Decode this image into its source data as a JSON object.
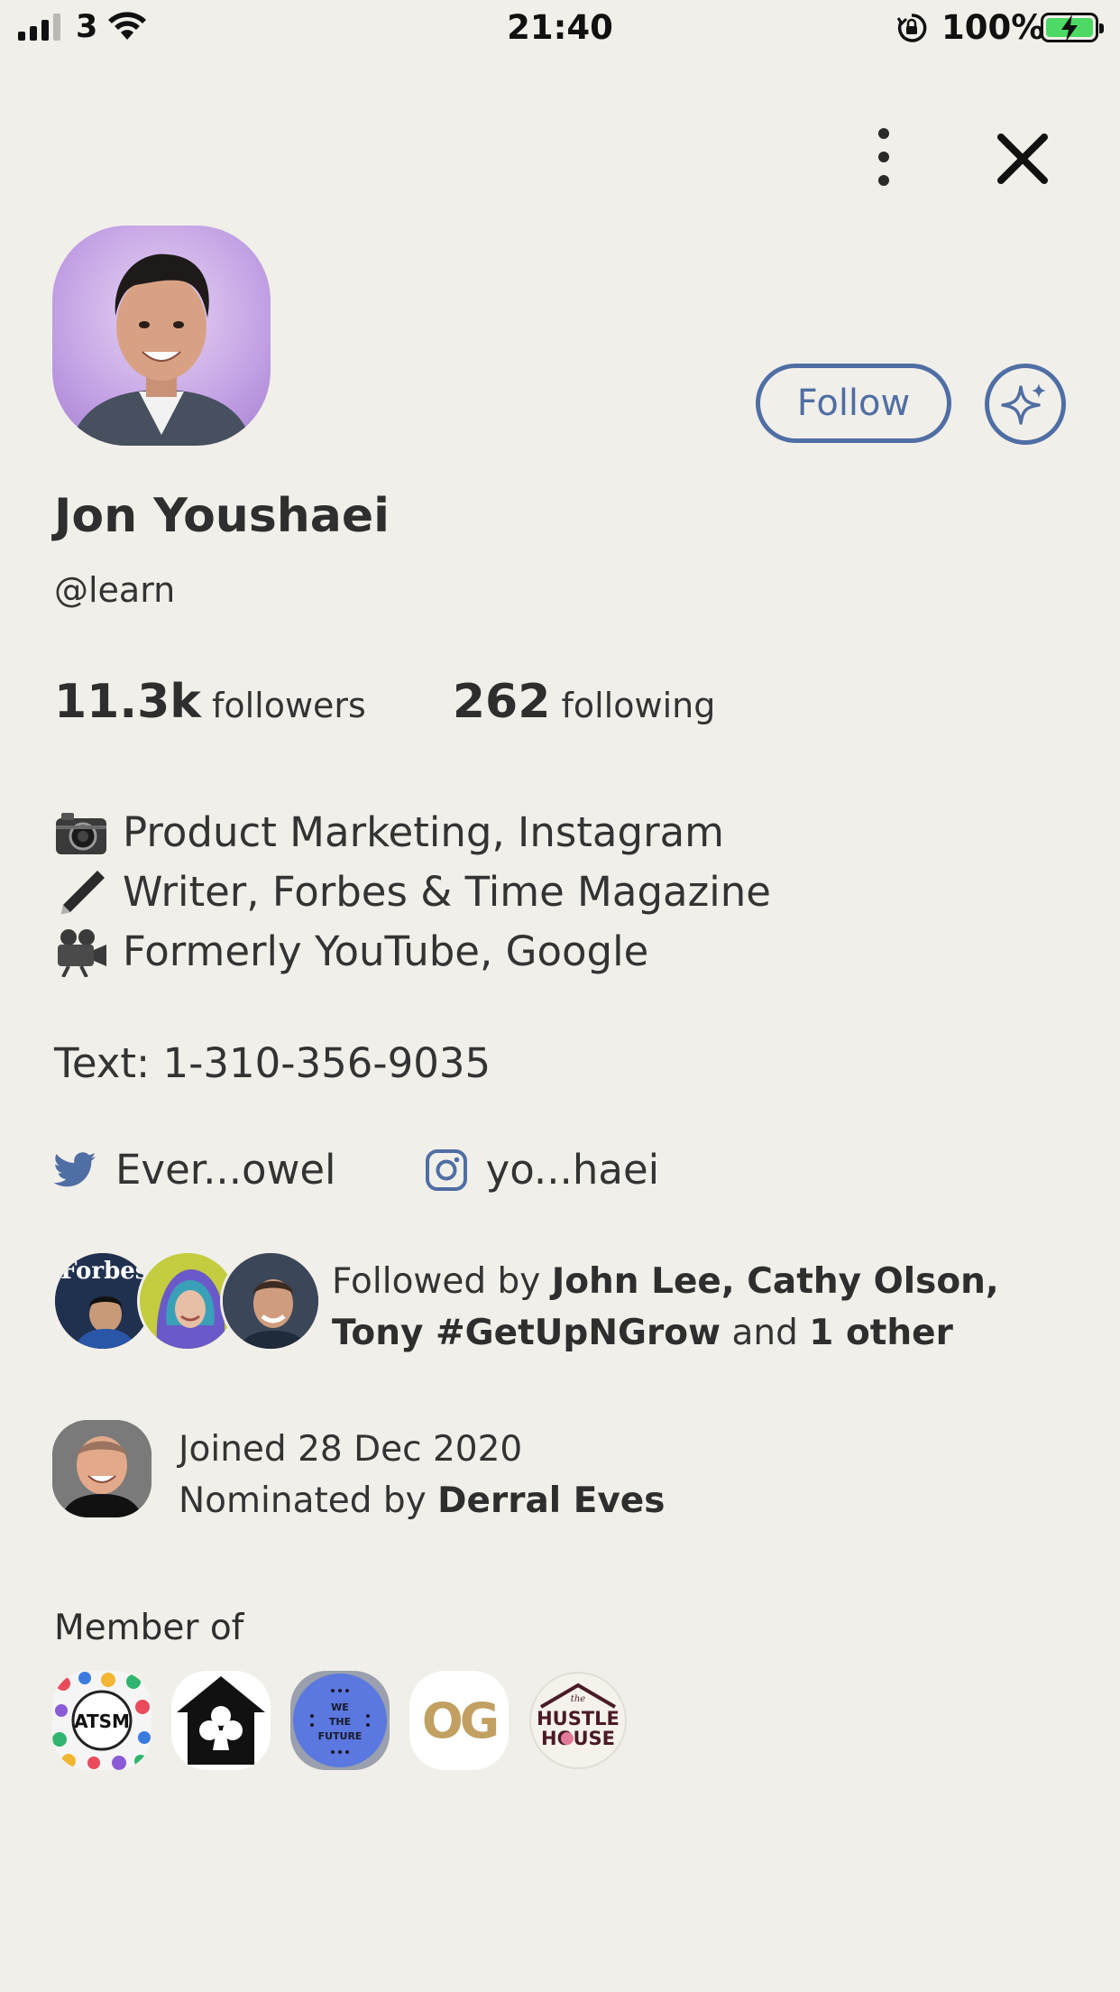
{
  "status_bar": {
    "carrier": "3",
    "time": "21:40",
    "battery_percent": "100%"
  },
  "profile": {
    "name": "Jon Youshaei",
    "handle": "@learn",
    "followers_count": "11.3k",
    "followers_label": "followers",
    "following_count": "262",
    "following_label": "following",
    "follow_label": "Follow"
  },
  "bio": {
    "lines": [
      {
        "icon": "camera-icon",
        "text": "Product Marketing, Instagram"
      },
      {
        "icon": "pen-icon",
        "text": "Writer, Forbes & Time Magazine"
      },
      {
        "icon": "movie-camera-icon",
        "text": "Formerly YouTube, Google"
      }
    ],
    "contact": "Text: 1-310-356-9035"
  },
  "socials": {
    "twitter": "Ever...owel",
    "instagram": "yo...haei"
  },
  "followed_by": {
    "prefix": "Followed by ",
    "names": "John Lee, Cathy Olson, Tony #GetUpNGrow",
    "and": " and ",
    "other": "1 other"
  },
  "joined": {
    "date_text": "Joined 28 Dec 2020",
    "nominated_prefix": "Nominated by ",
    "nominator": "Derral Eves"
  },
  "member_of": {
    "title": "Member of",
    "clubs": [
      {
        "name": "ATSM"
      },
      {
        "name": "clubhouse"
      },
      {
        "name": "WE THE FUTURE"
      },
      {
        "name": "OG"
      },
      {
        "name": "the HUSTLE HOUSE"
      }
    ]
  },
  "colors": {
    "background": "#f1efe9",
    "accent": "#4f6ea4",
    "twitter": "#4f6ea4",
    "text": "#2e2e2e"
  }
}
